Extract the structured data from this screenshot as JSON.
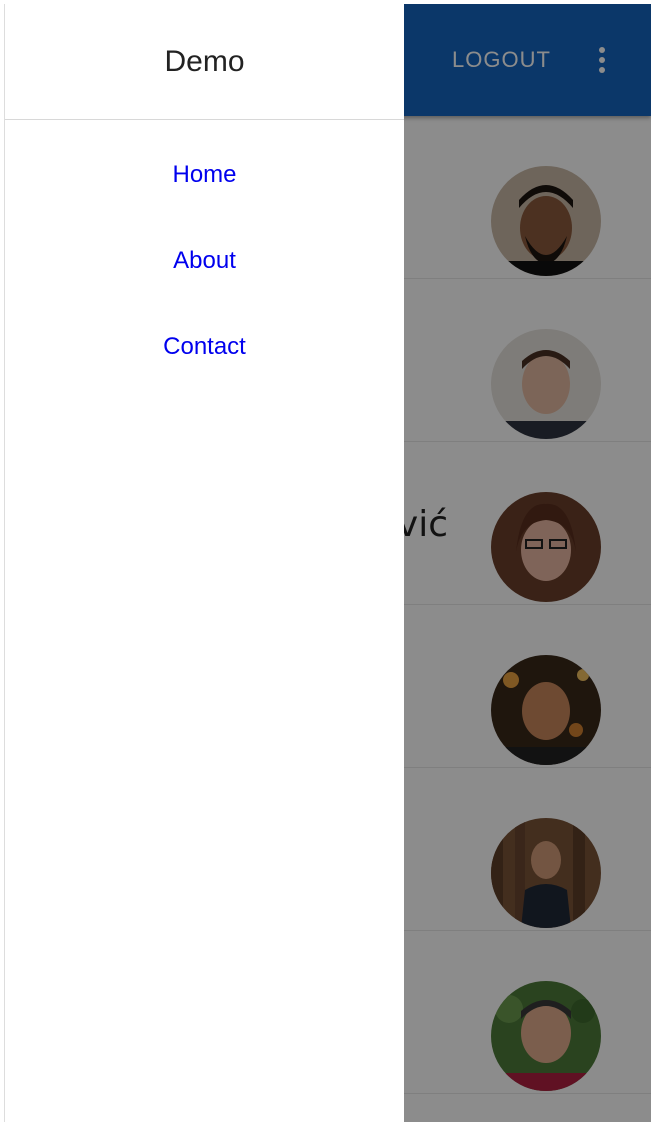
{
  "appbar": {
    "logout_label": "LOGOUT",
    "more_icon": "more-vert-icon",
    "color": "#1565c0"
  },
  "drawer": {
    "title": "Demo",
    "links": [
      {
        "label": "Home"
      },
      {
        "label": "About"
      },
      {
        "label": "Contact"
      }
    ]
  },
  "list": {
    "items": [
      {
        "name": "",
        "avatar": "person-avatar-1"
      },
      {
        "name": "",
        "avatar": "person-avatar-2"
      },
      {
        "name": "vić",
        "avatar": "person-avatar-3"
      },
      {
        "name": "",
        "avatar": "person-avatar-4"
      },
      {
        "name": "",
        "avatar": "person-avatar-5"
      },
      {
        "name": "",
        "avatar": "person-avatar-6"
      }
    ]
  }
}
